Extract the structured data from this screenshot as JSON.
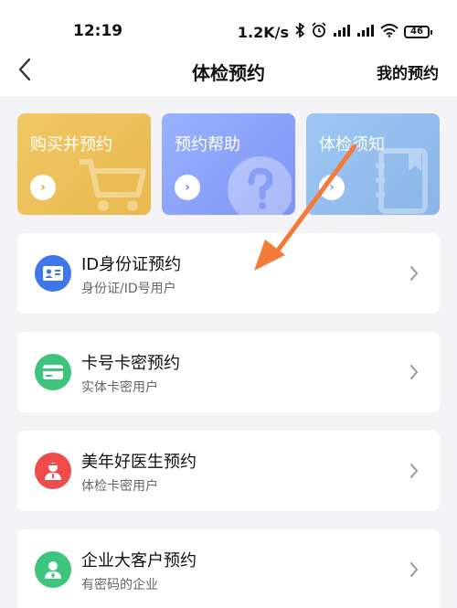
{
  "status_bar": {
    "time": "12:19",
    "network_speed": "1.2K/s",
    "battery": "46",
    "icons": [
      "bluetooth-icon",
      "alarm-icon",
      "signal-icon",
      "signal-icon",
      "wifi-icon",
      "battery-icon"
    ]
  },
  "nav": {
    "back_icon": "chevron-left-icon",
    "title": "体检预约",
    "action": "我的预约"
  },
  "tiles": [
    {
      "label": "购买并预约",
      "icon": "shopping-cart-icon",
      "color": "#e8b94e"
    },
    {
      "label": "预约帮助",
      "icon": "question-icon",
      "color": "#7d94f4"
    },
    {
      "label": "体检须知",
      "icon": "notebook-icon",
      "color": "#8ab5e8"
    }
  ],
  "cards": [
    {
      "title": "ID身份证预约",
      "subtitle": "身份证/ID号用户",
      "icon": "id-card-icon",
      "color": "#3e78e8"
    },
    {
      "title": "卡号卡密预约",
      "subtitle": "实体卡密用户",
      "icon": "card-icon",
      "color": "#3ec47c"
    },
    {
      "title": "美年好医生预约",
      "subtitle": "体检卡密用户",
      "icon": "doctor-icon",
      "color": "#ee4b4b"
    },
    {
      "title": "企业大客户预约",
      "subtitle": "有密码的企业",
      "icon": "enterprise-user-icon",
      "color": "#3ec47c"
    }
  ],
  "annotation_arrow_color": "#f47a3a"
}
